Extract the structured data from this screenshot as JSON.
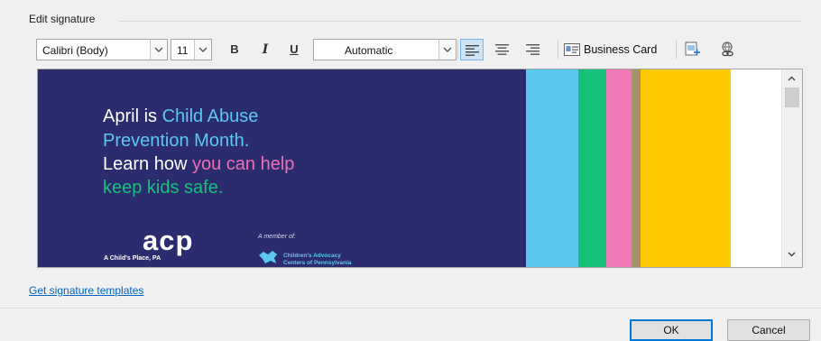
{
  "section": {
    "title": "Edit signature"
  },
  "toolbar": {
    "font_name": "Calibri (Body)",
    "font_size": "11",
    "bold_label": "B",
    "italic_label": "I",
    "underline_label": "U",
    "color_value": "Automatic",
    "business_card_label": "Business Card",
    "icons": [
      "align-left-icon",
      "align-center-icon",
      "align-right-icon",
      "business-card-icon",
      "insert-picture-icon",
      "hyperlink-icon"
    ]
  },
  "signature": {
    "line1_a": "April is ",
    "line1_b": "Child Abuse",
    "line2": "Prevention Month.",
    "line3_a": "Learn how ",
    "line3_b": "you can help",
    "line4": "keep kids safe.",
    "logo_text": "acp",
    "org_name": "A Child's Place, PA",
    "member_of": "A member of:",
    "cac_line1": "Children's Advocacy",
    "cac_line2": "Centers of Pennsylvania",
    "colors": {
      "navy": "#2a2c6e",
      "sky": "#5bc8f2",
      "green": "#19c07a",
      "pink": "#f07ab8",
      "tan": "#a6926a",
      "yellow": "#fdca00"
    }
  },
  "links": {
    "templates": "Get signature templates"
  },
  "buttons": {
    "ok": "OK",
    "cancel": "Cancel"
  }
}
